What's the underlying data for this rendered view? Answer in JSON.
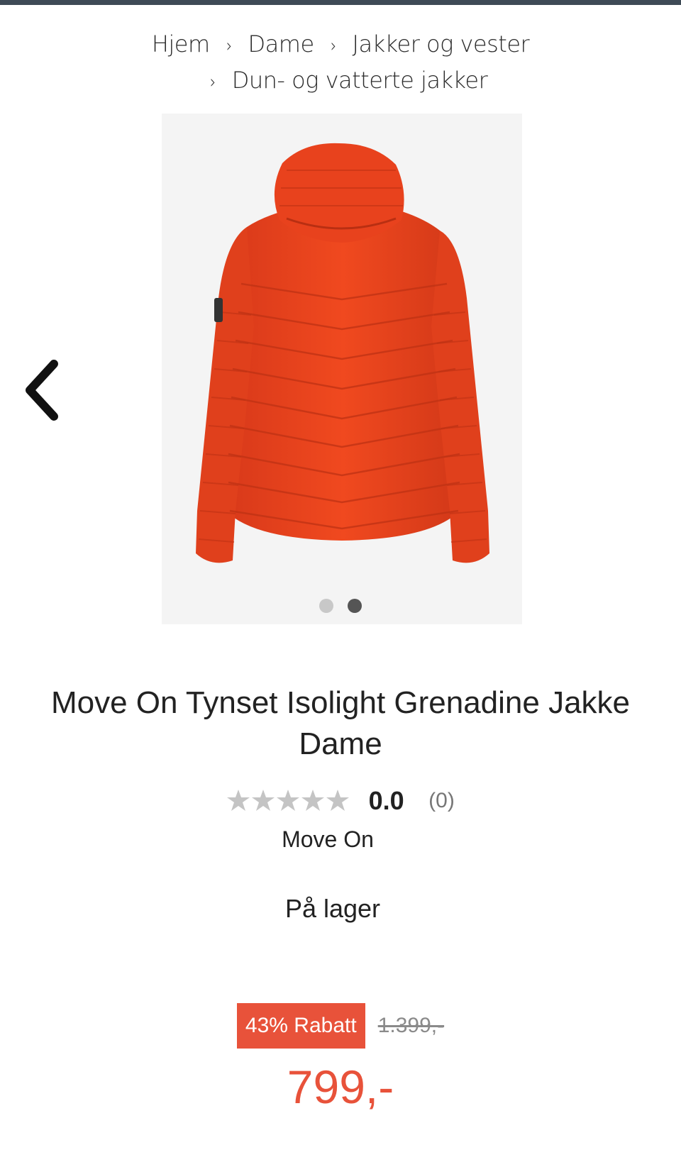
{
  "breadcrumb": {
    "items": [
      "Hjem",
      "Dame",
      "Jakker og vester",
      "Dun- og vatterte jakker"
    ],
    "separator": "›"
  },
  "gallery": {
    "image_icon": "jacket-back-view",
    "jacket_color": "#e8421d",
    "dots_total": 2,
    "active_dot": 2,
    "prev_icon": "chevron-left-icon"
  },
  "product": {
    "title": "Move On Tynset Isolight Grenadine Jakke Dame",
    "rating_score": "0.0",
    "rating_count": "(0)",
    "stars_filled": 0,
    "stars_total": 5,
    "brand": "Move On",
    "stock_status": "På lager"
  },
  "pricing": {
    "discount_label": "43% Rabatt",
    "old_price": "1.399,-",
    "new_price": "799,-"
  },
  "colors": {
    "accent": "#e8523a",
    "topbar": "#3e4a56",
    "star_empty": "#c4c4c4"
  }
}
